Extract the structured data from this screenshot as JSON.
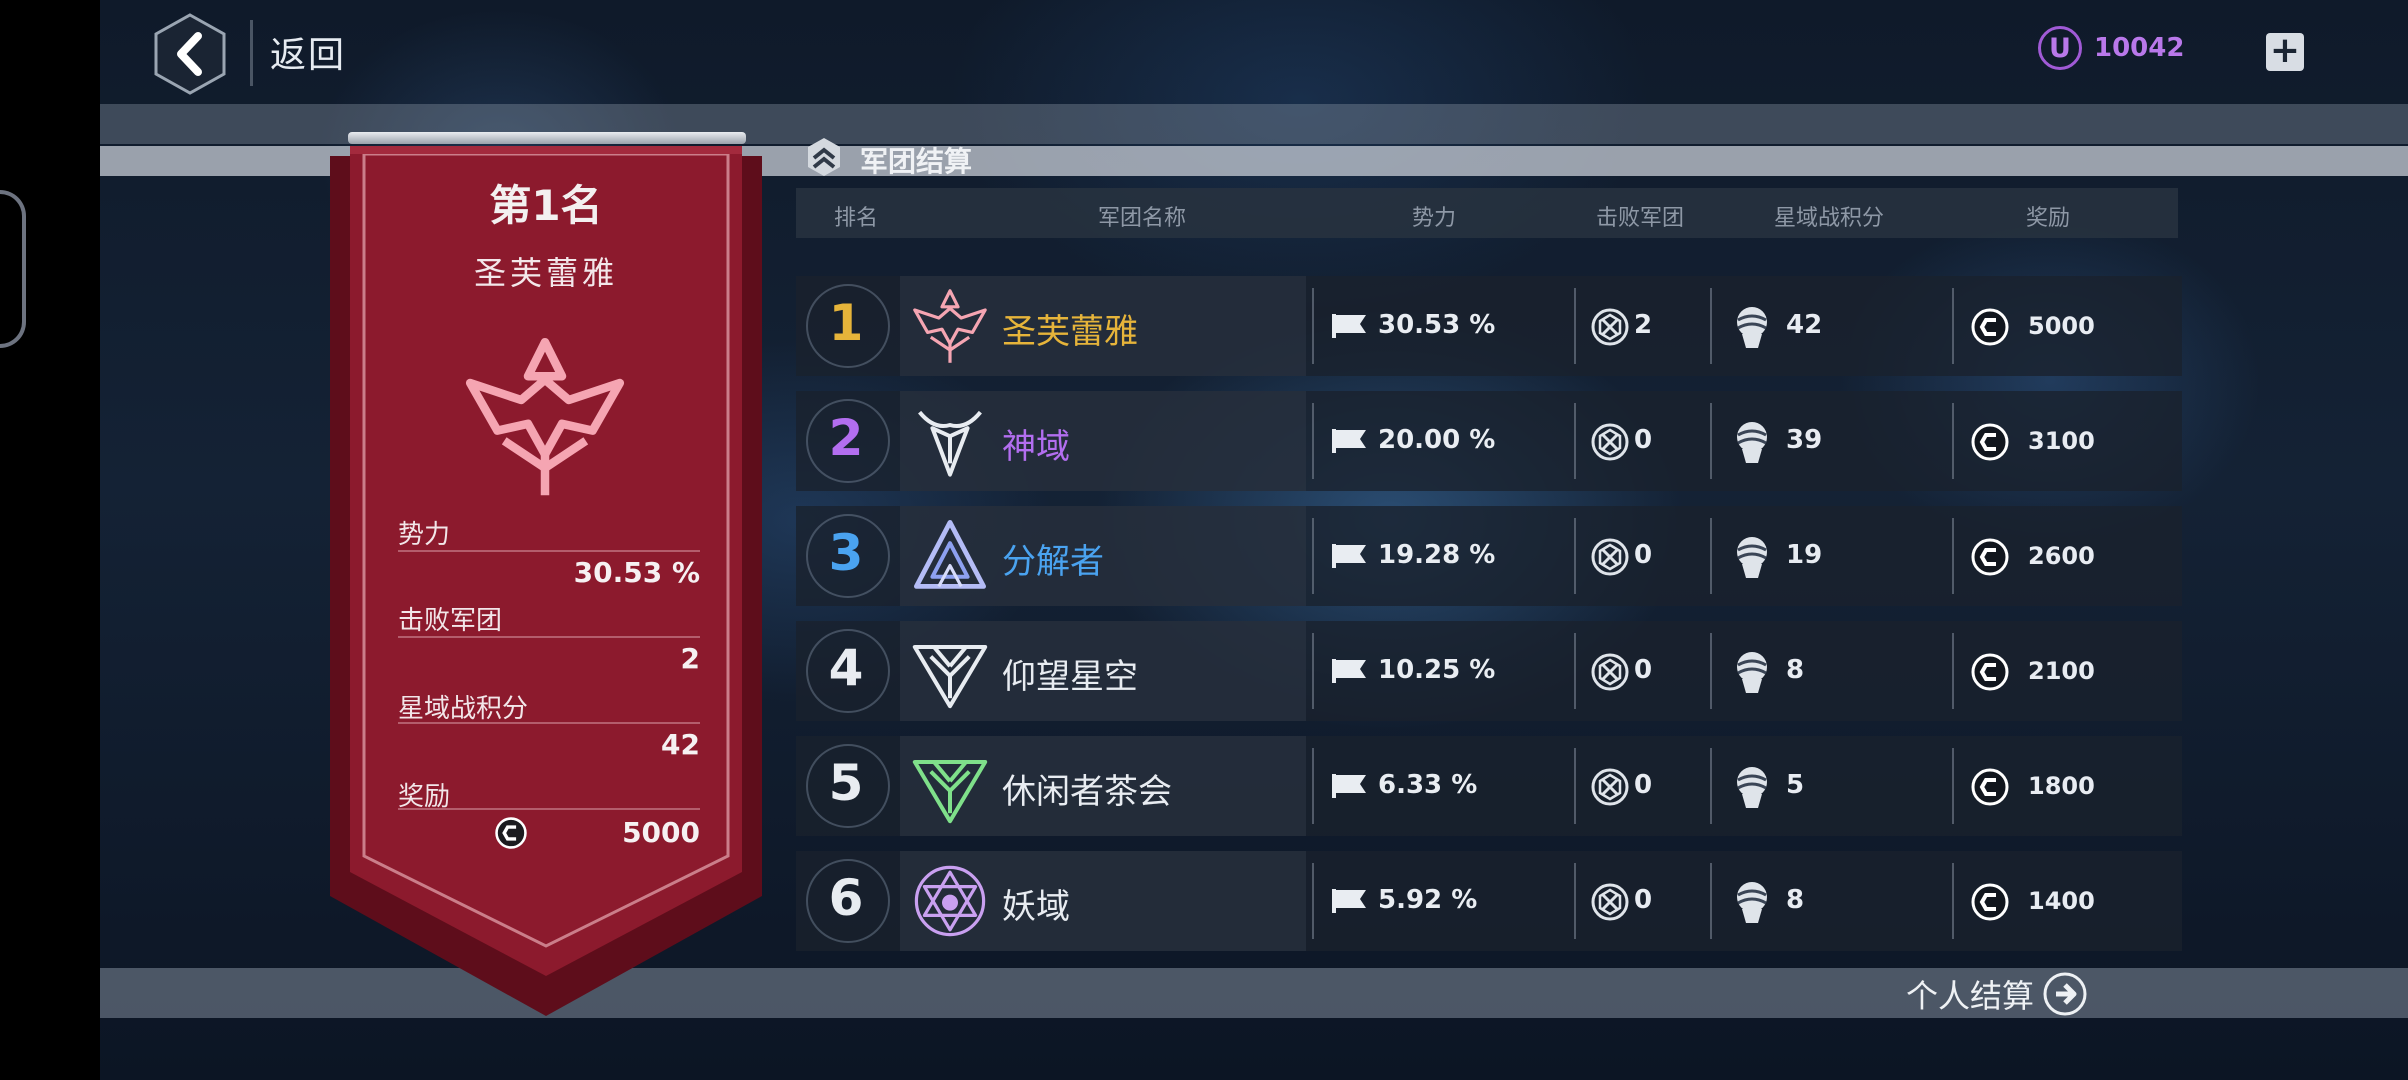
{
  "header": {
    "back_label": "返回",
    "currency_value": "10042",
    "currency_icon_letter": "U"
  },
  "section": {
    "title": "军团结算"
  },
  "columns": [
    "排名",
    "军团名称",
    "势力",
    "击败军团",
    "星域战积分",
    "奖励"
  ],
  "banner": {
    "rank_title": "第1名",
    "name": "圣芙蕾雅",
    "stats": [
      {
        "label": "势力",
        "value": "30.53 %"
      },
      {
        "label": "击败军团",
        "value": "2"
      },
      {
        "label": "星域战积分",
        "value": "42"
      },
      {
        "label": "奖励",
        "value": "5000"
      }
    ],
    "color": "#7e1427"
  },
  "rows": [
    {
      "rank": "1",
      "name": "圣芙蕾雅",
      "power": "30.53 %",
      "defeated": "2",
      "score": "42",
      "reward": "5000",
      "color": "#e6b43a",
      "emblem": "valkyrie-emblem-icon"
    },
    {
      "rank": "2",
      "name": "神域",
      "power": "20.00 %",
      "defeated": "0",
      "score": "39",
      "reward": "3100",
      "color": "#b36ef0",
      "emblem": "horned-emblem-icon"
    },
    {
      "rank": "3",
      "name": "分解者",
      "power": "19.28 %",
      "defeated": "0",
      "score": "19",
      "reward": "2600",
      "color": "#4aa3f0",
      "emblem": "triangle-emblem-icon"
    },
    {
      "rank": "4",
      "name": "仰望星空",
      "power": "10.25 %",
      "defeated": "0",
      "score": "8",
      "reward": "2100",
      "color": "#e8ecf1",
      "emblem": "star-emblem-icon"
    },
    {
      "rank": "5",
      "name": "休闲者茶会",
      "power": "6.33 %",
      "defeated": "0",
      "score": "5",
      "reward": "1800",
      "color": "#e8ecf1",
      "emblem": "green-star-emblem-icon"
    },
    {
      "rank": "6",
      "name": "妖域",
      "power": "5.92 %",
      "defeated": "0",
      "score": "8",
      "reward": "1400",
      "color": "#e8ecf1",
      "emblem": "hexagram-emblem-icon"
    }
  ],
  "footer": {
    "personal_label": "个人结算"
  }
}
